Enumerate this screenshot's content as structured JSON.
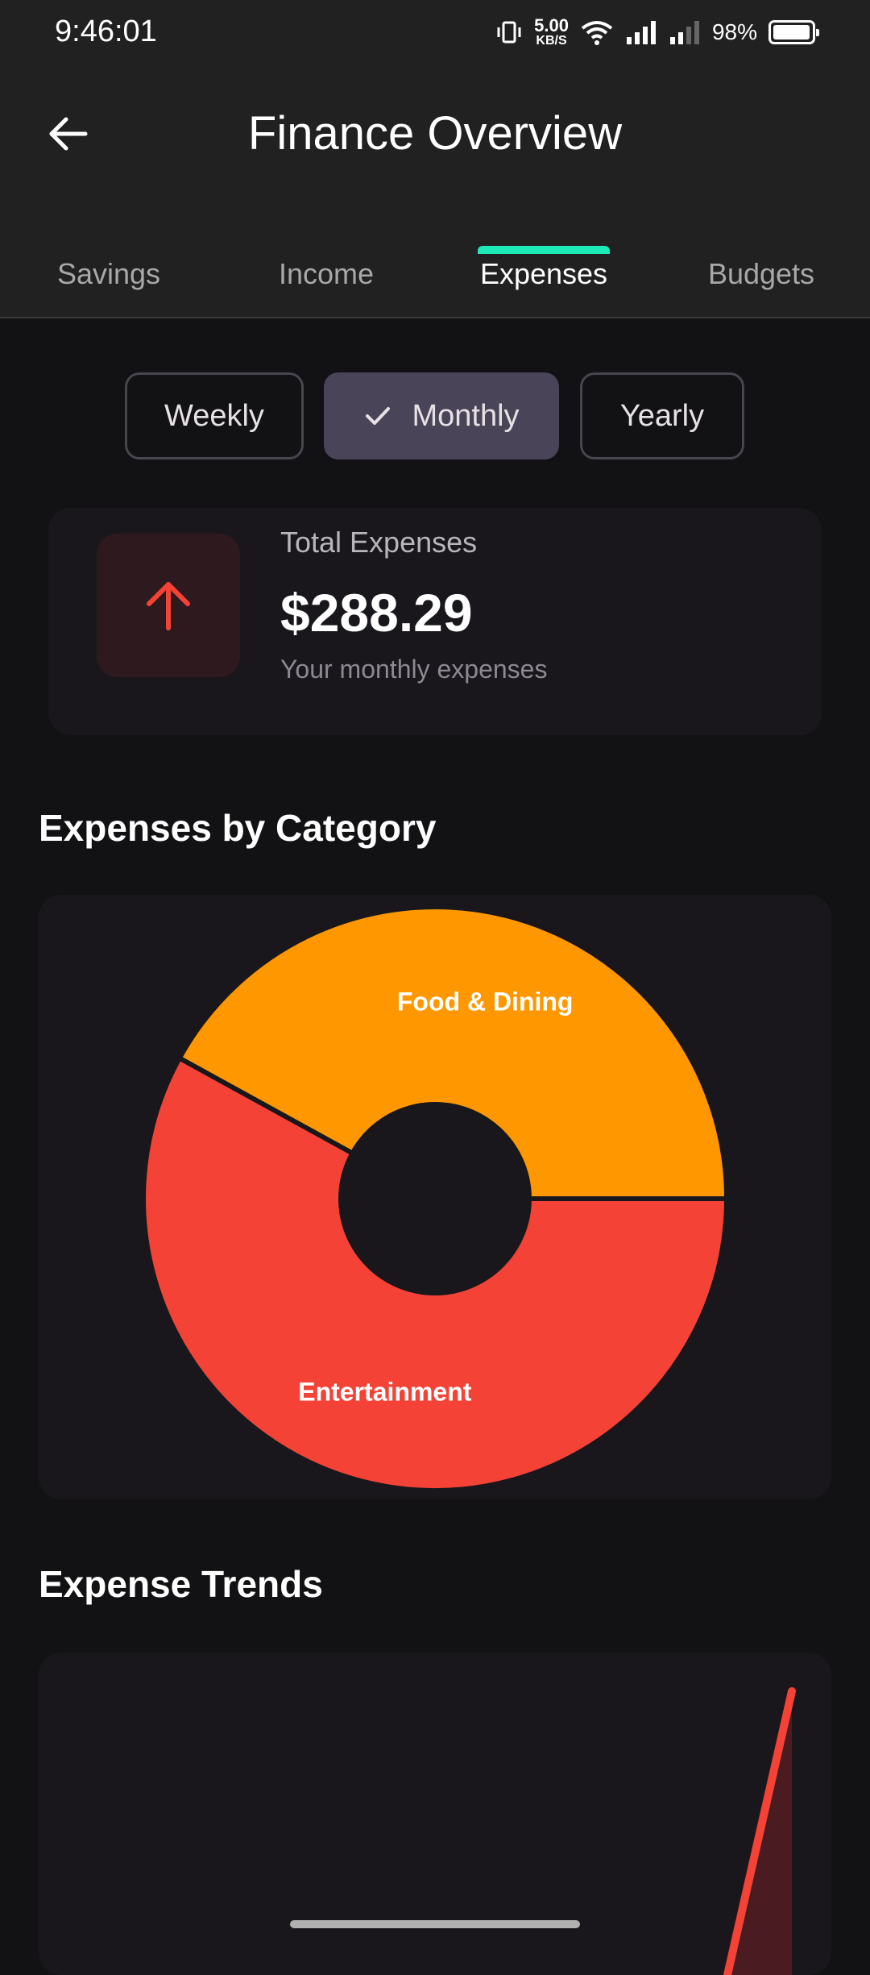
{
  "status_bar": {
    "time": "9:46:01",
    "net_speed_value": "5.00",
    "net_speed_unit": "KB/S",
    "battery_percent": "98%",
    "battery_level": 0.98
  },
  "app_bar": {
    "title": "Finance Overview",
    "back_icon": "arrow-left-icon"
  },
  "tabs": [
    {
      "label": "Savings",
      "active": false
    },
    {
      "label": "Income",
      "active": false
    },
    {
      "label": "Expenses",
      "active": true
    },
    {
      "label": "Budgets",
      "active": false
    }
  ],
  "accent_color": "#1de9b6",
  "period_selector": {
    "options": [
      "Weekly",
      "Monthly",
      "Yearly"
    ],
    "selected": "Monthly",
    "check_icon": "check-icon"
  },
  "total_card": {
    "icon": "arrow-up-icon",
    "icon_color": "#f44336",
    "label": "Total Expenses",
    "amount": "$288.29",
    "subtitle": "Your monthly expenses"
  },
  "category_section": {
    "title": "Expenses by Category"
  },
  "trend_section": {
    "title": "Expense Trends"
  },
  "chart_data": [
    {
      "type": "pie",
      "title": "Expenses by Category",
      "donut": true,
      "labels": [
        "Food & Dining",
        "Entertainment"
      ],
      "values": [
        42,
        58
      ],
      "colors": [
        "#ff9800",
        "#f44336"
      ]
    },
    {
      "type": "line",
      "title": "Expense Trends",
      "series_color": "#f44336",
      "fill_color": "#4a1c22"
    }
  ]
}
